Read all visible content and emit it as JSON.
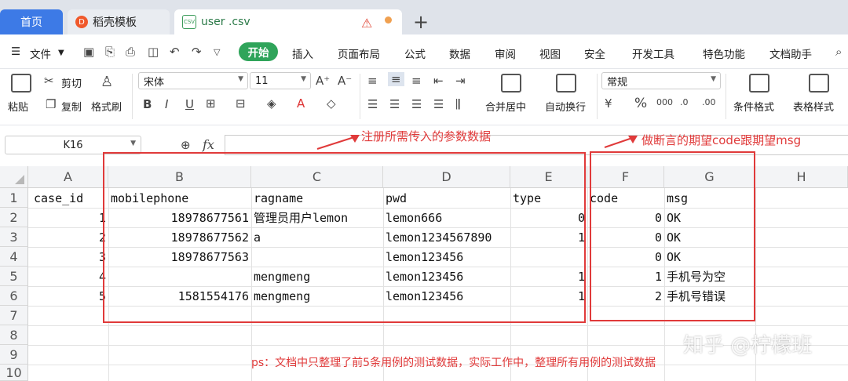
{
  "tabs": {
    "home": "首页",
    "template": "稻壳模板",
    "file": "user .csv"
  },
  "menu": {
    "file": "文件",
    "items": [
      "开始",
      "插入",
      "页面布局",
      "公式",
      "数据",
      "审阅",
      "视图",
      "安全",
      "开发工具",
      "特色功能",
      "文档助手"
    ]
  },
  "ribbon": {
    "paste": "粘贴",
    "cut": "剪切",
    "copy": "复制",
    "format_painter": "格式刷",
    "font_name": "宋体",
    "font_size": "11",
    "merge": "合并居中",
    "wrap": "自动换行",
    "number_format": "常规",
    "cond_format": "条件格式",
    "table_style": "表格样式"
  },
  "formula_bar": {
    "cell_ref": "K16",
    "fx": "fx"
  },
  "sheet": {
    "columns": [
      "A",
      "B",
      "C",
      "D",
      "E",
      "F",
      "G",
      "H"
    ],
    "rows": [
      "1",
      "2",
      "3",
      "4",
      "5",
      "6",
      "7",
      "8",
      "9",
      "10"
    ],
    "header": [
      "case_id",
      "mobilephone",
      "ragname",
      "pwd",
      "type",
      "code",
      "msg"
    ],
    "data": [
      [
        "1",
        "18978677561",
        "管理员用户lemon",
        "lemon666",
        "0",
        "0",
        "OK"
      ],
      [
        "2",
        "18978677562",
        "a",
        "lemon1234567890",
        "1",
        "0",
        "OK"
      ],
      [
        "3",
        "18978677563",
        "",
        "lemon123456",
        "",
        "0",
        "OK"
      ],
      [
        "4",
        "",
        "mengmeng",
        "lemon123456",
        "1",
        "1",
        "手机号为空"
      ],
      [
        "5",
        "1581554176",
        "mengmeng",
        "lemon123456",
        "1",
        "2",
        "手机号错误"
      ]
    ]
  },
  "annotations": {
    "params_note": "注册所需传入的参数数据",
    "assert_note": "做断言的期望code跟期望msg",
    "ps_note": "ps：文档中只整理了前5条用例的测试数据，实际工作中，整理所有用例的测试数据",
    "watermark": "知乎 @柠檬班"
  },
  "colors": {
    "accent": "#2fa45a",
    "annotation": "#e03a3a"
  }
}
